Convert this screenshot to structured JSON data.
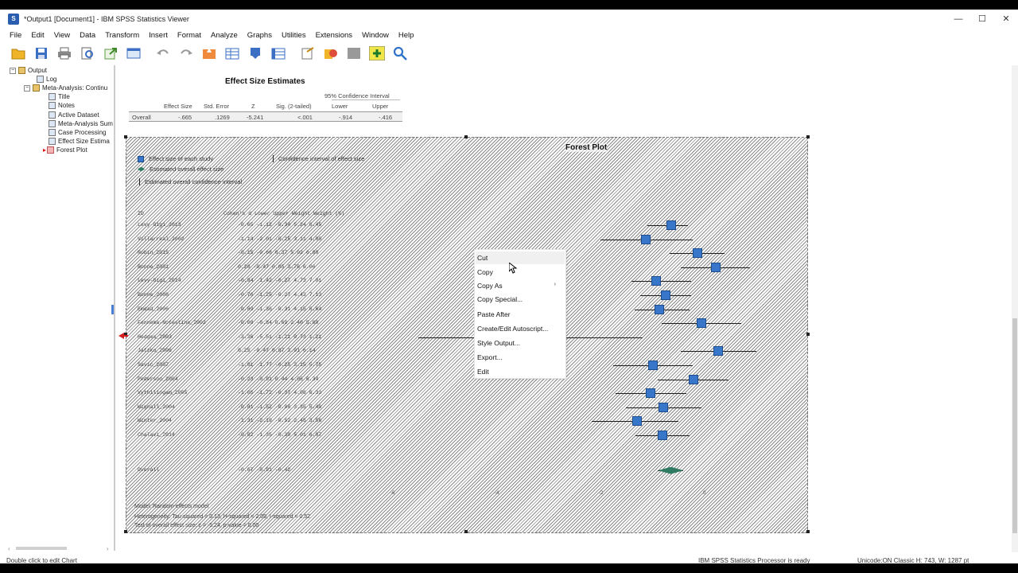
{
  "window": {
    "title": "*Output1 [Document1] - IBM SPSS Statistics Viewer",
    "minimize": "—",
    "maximize": "☐",
    "close": "✕"
  },
  "menu": [
    "File",
    "Edit",
    "View",
    "Data",
    "Transform",
    "Insert",
    "Format",
    "Analyze",
    "Graphs",
    "Utilities",
    "Extensions",
    "Window",
    "Help"
  ],
  "toolbar_icons": [
    "open-icon",
    "save-icon",
    "print-icon",
    "print-preview-icon",
    "export-icon",
    "recall-dialog-icon",
    "undo-icon",
    "redo-icon",
    "goto-data-icon",
    "goto-case-icon",
    "goto-variable-icon",
    "variables-icon",
    "insert-output-icon",
    "edit-output-icon",
    "insert-chart-icon",
    "designate-window-icon",
    "search-icon"
  ],
  "nav_tree": [
    {
      "label": "Output",
      "level": 0,
      "icon": "book",
      "expander": "−"
    },
    {
      "label": "Log",
      "level": 1,
      "icon": "page"
    },
    {
      "label": "Meta-Analysis: Continu",
      "level": 1,
      "icon": "book",
      "expander": "−"
    },
    {
      "label": "Title",
      "level": 2,
      "icon": "page"
    },
    {
      "label": "Notes",
      "level": 2,
      "icon": "page"
    },
    {
      "label": "Active Dataset",
      "level": 2,
      "icon": "page"
    },
    {
      "label": "Meta-Analysis Sum",
      "level": 2,
      "icon": "page"
    },
    {
      "label": "Case Processing",
      "level": 2,
      "icon": "page"
    },
    {
      "label": "Effect Size Estima",
      "level": 2,
      "icon": "page"
    },
    {
      "label": "Forest Plot",
      "level": 2,
      "icon": "sel"
    }
  ],
  "estimates": {
    "title": "Effect Size Estimates",
    "ci_header": "95% Confidence Interval",
    "columns": [
      "Effect Size",
      "Std. Error",
      "Z",
      "Sig. (2-tailed)",
      "Lower",
      "Upper"
    ],
    "row_label": "Overall",
    "values": [
      "-.665",
      ".1269",
      "-5.241",
      "<.001",
      "-.914",
      "-.416"
    ]
  },
  "forest": {
    "title": "Forest Plot",
    "legend": {
      "study": "Effect size of each study",
      "ci": "Confidence interval of effect size",
      "overall": "Estimated overall effect size",
      "overall_ci": "Estimated overall confidence interval"
    },
    "header_id": "ID",
    "header_stats": "Cohen's d  Lower  Upper  Weight  Weight (%)",
    "studies": [
      {
        "id": "Levy-Gigi_2013",
        "stats": "-0.65  -1.12  -0.34   5.24    6.45",
        "est": -0.65,
        "lo": -1.12,
        "hi": -0.34
      },
      {
        "id": "Villarreal_2002",
        "stats": "-1.14  -2.01  -0.25   3.11    4.00",
        "est": -1.14,
        "lo": -2.01,
        "hi": -0.25
      },
      {
        "id": "Rubin_2015",
        "stats": "-0.15  -0.68   0.37   5.02    6.00",
        "est": -0.15,
        "lo": -0.68,
        "hi": 0.37
      },
      {
        "id": "Bonne_2001",
        "stats": " 0.20  -0.47   0.85   3.76    6.06",
        "est": 0.2,
        "lo": -0.47,
        "hi": 0.85
      },
      {
        "id": "Levy-Gigi_2014",
        "stats": "-0.94  -1.42  -0.27   4.73    7.01",
        "est": -0.94,
        "lo": -1.42,
        "hi": -0.27
      },
      {
        "id": "Bonne_2008",
        "stats": "-0.76  -1.25  -0.27   4.43    7.13",
        "est": -0.76,
        "lo": -1.25,
        "hi": -0.27
      },
      {
        "id": "Emdad_2006",
        "stats": "-0.89  -1.36  -0.31   4.15    6.64",
        "est": -0.89,
        "lo": -1.36,
        "hi": -0.31
      },
      {
        "id": "Fennema-Notestine_2002",
        "stats": "-0.08  -0.84   0.69   2.40    5.60",
        "est": -0.08,
        "lo": -0.84,
        "hi": 0.69
      },
      {
        "id": "Hedges_2003",
        "stats": "-3.36  -5.51  -1.21   0.73    1.21",
        "est": -3.36,
        "lo": -5.51,
        "hi": -1.21
      },
      {
        "id": "Jatzko_2006",
        "stats": " 0.25  -0.47   0.97   3.01    6.14",
        "est": 0.25,
        "lo": -0.47,
        "hi": 0.97
      },
      {
        "id": "Savic_2007",
        "stats": "-1.01  -1.77  -0.25   3.15    5.75",
        "est": -1.01,
        "lo": -1.77,
        "hi": -0.25
      },
      {
        "id": "Pederson_2004",
        "stats": "-0.23  -0.91   0.44   4.06    6.34",
        "est": -0.23,
        "lo": -0.91,
        "hi": 0.44
      },
      {
        "id": "Vythilingam_2005",
        "stats": "-1.05  -1.72  -0.37   4.06    6.33",
        "est": -1.05,
        "lo": -1.72,
        "hi": -0.37
      },
      {
        "id": "Wignall_2004",
        "stats": "-0.81  -1.52  -0.08   3.35    5.40",
        "est": -0.81,
        "lo": -1.52,
        "hi": -0.08
      },
      {
        "id": "Winter_2004",
        "stats": "-1.31  -2.19  -0.52   2.45    3.56",
        "est": -1.31,
        "lo": -2.19,
        "hi": -0.52
      },
      {
        "id": "Chalavi_2014",
        "stats": "-0.82  -1.35  -0.30   5.01    6.07",
        "est": -0.82,
        "lo": -1.35,
        "hi": -0.3
      }
    ],
    "overall": {
      "id": "Overall",
      "stats": "-0.67  -0.91  -0.42",
      "est": -0.67,
      "lo": -0.91,
      "hi": -0.42
    },
    "axis_ticks": [
      "-6",
      "-4",
      "-2",
      "0"
    ],
    "model": "Model: Random-effects model",
    "heterogeneity": "Heterogeneity: Tau-squared = 0.13, H-squared = 2.09, I-squared = 0.52",
    "overall_test": "Test of overall effect size: z = -5.24, p-value = 0.00"
  },
  "context_menu": {
    "items": [
      "Cut",
      "Copy",
      "Copy As",
      "Copy Special...",
      "Paste After",
      "Create/Edit Autoscript...",
      "Style Output...",
      "Export...",
      "Edit"
    ],
    "submenu_arrow": "›"
  },
  "status": {
    "left": "Double click to edit Chart",
    "mid": "IBM SPSS Statistics Processor is ready",
    "right": "Unicode:ON   Classic   H: 743, W: 1287 pt"
  }
}
